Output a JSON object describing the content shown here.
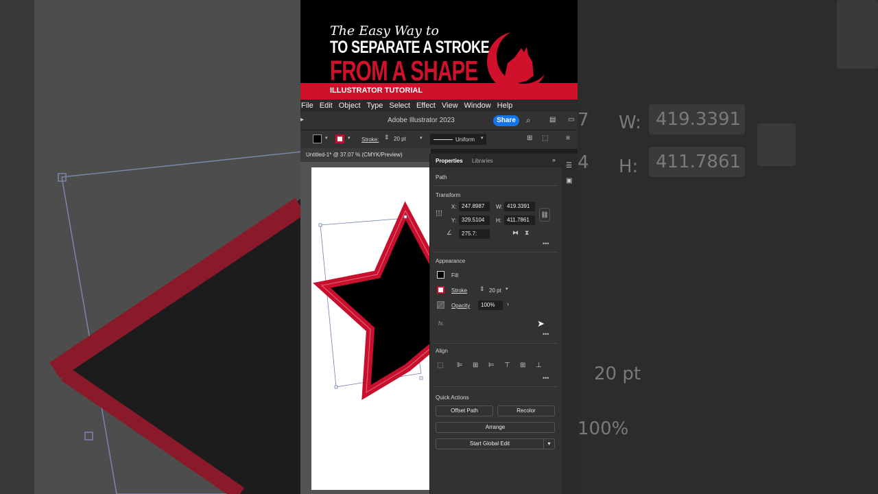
{
  "banner": {
    "line1": "The Easy Way to",
    "line2": "TO SEPARATE A STROKE",
    "line3": "FROM A SHAPE",
    "tag": "ILLUSTRATOR TUTORIAL"
  },
  "menu": [
    "File",
    "Edit",
    "Object",
    "Type",
    "Select",
    "Effect",
    "View",
    "Window",
    "Help"
  ],
  "titlebar": {
    "app_title": "Adobe Illustrator 2023",
    "share_label": "Share"
  },
  "control_bar": {
    "stroke_label": "Stroke:",
    "stroke_value": "20 pt",
    "profile": "Uniform"
  },
  "document_tab": "Untitled-1* @ 37.07 % (CMYK/Preview)",
  "properties": {
    "tabs": [
      "Properties",
      "Libraries"
    ],
    "selection_type": "Path",
    "transform": {
      "title": "Transform",
      "x_label": "X:",
      "x": "247.8987",
      "y_label": "Y:",
      "y": "329.5104",
      "w_label": "W:",
      "w": "419.3391",
      "h_label": "H:",
      "h": "411.7861",
      "angle": "275.7:"
    },
    "appearance": {
      "title": "Appearance",
      "fill_label": "Fill",
      "stroke_label": "Stroke",
      "stroke_value": "20 pt",
      "opacity_label": "Opacity",
      "opacity_value": "100%",
      "fx": "fx."
    },
    "align": {
      "title": "Align"
    },
    "quick_actions": {
      "title": "Quick Actions",
      "offset_path": "Offset Path",
      "recolor": "Recolor",
      "arrange": "Arrange",
      "global_edit": "Start Global Edit"
    }
  },
  "background_right": {
    "w_label": "W:",
    "w_value": "419.3391",
    "h_label": "H:",
    "h_value": "411.7861",
    "stroke_value": "20 pt",
    "opacity_value": "100%"
  },
  "colors": {
    "brand_red": "#d0112b",
    "accent_blue": "#1473e6",
    "stroke_red": "#c8102e"
  }
}
